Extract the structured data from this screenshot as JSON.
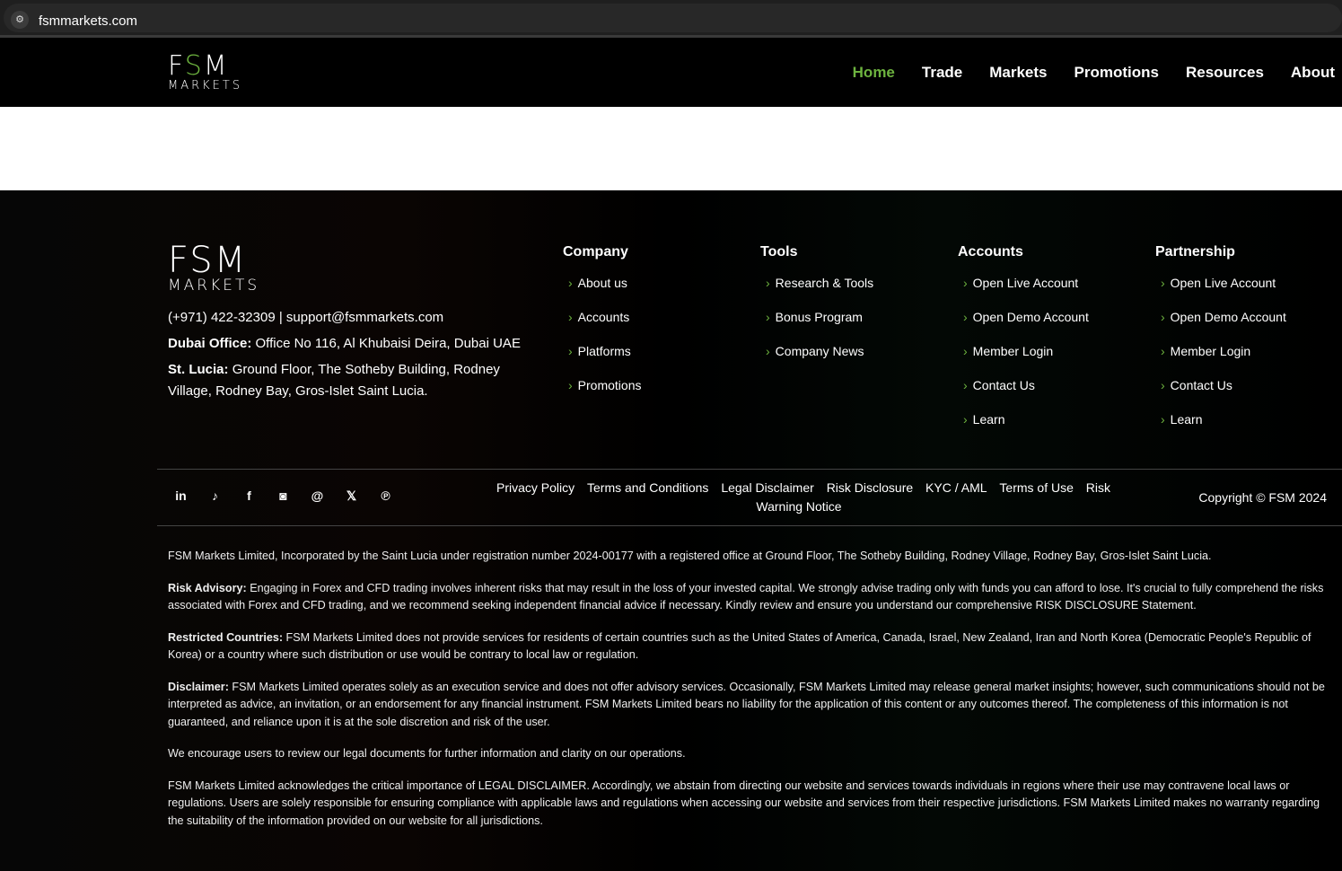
{
  "browser": {
    "url": "fsmmarkets.com"
  },
  "logo": {
    "line1": "FSM",
    "line2": "MARKETS"
  },
  "nav": [
    "Home",
    "Trade",
    "Markets",
    "Promotions",
    "Resources",
    "About"
  ],
  "contact": {
    "phone_email": "(+971) 422-32309 | support@fsmmarkets.com",
    "dubai_label": "Dubai Office:",
    "dubai": "Office No 116, Al Khubaisi Deira, Dubai UAE",
    "lucia_label": "St. Lucia:",
    "lucia": "Ground Floor, The Sotheby Building, Rodney Village, Rodney Bay, Gros-Islet Saint Lucia."
  },
  "columns": [
    {
      "title": "Company",
      "items": [
        "About us",
        "Accounts",
        "Platforms",
        "Promotions"
      ]
    },
    {
      "title": "Tools",
      "items": [
        "Research & Tools",
        "Bonus Program",
        "Company News"
      ]
    },
    {
      "title": "Accounts",
      "items": [
        "Open Live Account",
        "Open Demo Account",
        "Member Login",
        "Contact Us",
        "Learn"
      ]
    },
    {
      "title": "Partnership",
      "items": [
        "Open Live Account",
        "Open Demo Account",
        "Member Login",
        "Contact Us",
        "Learn"
      ]
    }
  ],
  "social": [
    "linkedin-icon",
    "tiktok-icon",
    "facebook-icon",
    "instagram-icon",
    "threads-icon",
    "x-icon",
    "pinterest-icon"
  ],
  "legal_links": [
    "Privacy Policy",
    "Terms and Conditions",
    "Legal Disclaimer",
    "Risk Disclosure",
    "KYC / AML",
    "Terms of Use",
    "Risk Warning Notice"
  ],
  "copyright": "Copyright © FSM 2024",
  "legal": [
    {
      "label": "",
      "text": "FSM Markets Limited, Incorporated by the Saint Lucia under registration number 2024-00177 with a registered office at Ground Floor, The Sotheby Building, Rodney Village, Rodney Bay, Gros-Islet Saint Lucia."
    },
    {
      "label": "Risk Advisory:",
      "text": " Engaging in Forex and CFD trading involves inherent risks that may result in the loss of your invested capital. We strongly advise trading only with funds you can afford to lose. It's crucial to fully comprehend the risks associated with Forex and CFD trading, and we recommend seeking independent financial advice if necessary. Kindly review and ensure you understand our comprehensive RISK DISCLOSURE Statement."
    },
    {
      "label": "Restricted Countries:",
      "text": " FSM Markets Limited does not provide services for residents of certain countries such as the United States of America, Canada, Israel, New Zealand, Iran and North Korea (Democratic People's Republic of Korea) or a country where such distribution or use would be contrary to local law or regulation."
    },
    {
      "label": "Disclaimer:",
      "text": " FSM Markets Limited operates solely as an execution service and does not offer advisory services. Occasionally, FSM Markets Limited may release general market insights; however, such communications should not be interpreted as advice, an invitation, or an endorsement for any financial instrument. FSM Markets Limited bears no liability for the application of this content or any outcomes thereof. The completeness of this information is not guaranteed, and reliance upon it is at the sole discretion and risk of the user."
    },
    {
      "label": "",
      "text": "We encourage users to review our legal documents for further information and clarity on our operations."
    },
    {
      "label": "",
      "text": "FSM Markets Limited acknowledges the critical importance of LEGAL DISCLAIMER. Accordingly, we abstain from directing our website and services towards individuals in regions where their use may contravene local laws or regulations. Users are solely responsible for ensuring compliance with applicable laws and regulations when accessing our website and services from their respective jurisdictions. FSM Markets Limited makes no warranty regarding the suitability of the information provided on our website for all jurisdictions."
    }
  ],
  "colors": {
    "accent": "#6db33f"
  }
}
